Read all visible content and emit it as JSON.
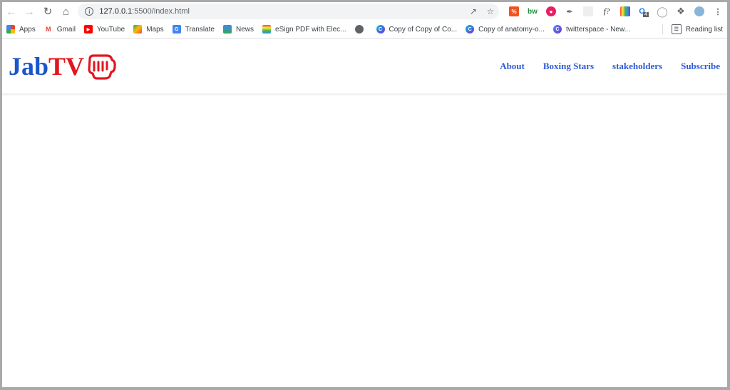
{
  "browser": {
    "url_host": "127.0.0.1",
    "url_rest": ":5500/index.html",
    "bookmarks": [
      {
        "label": "Apps",
        "icon": "apps-grid-icon"
      },
      {
        "label": "Gmail",
        "icon": "gmail-icon"
      },
      {
        "label": "YouTube",
        "icon": "youtube-icon"
      },
      {
        "label": "Maps",
        "icon": "maps-icon"
      },
      {
        "label": "Translate",
        "icon": "translate-icon"
      },
      {
        "label": "News",
        "icon": "news-icon"
      },
      {
        "label": "eSign PDF with Elec...",
        "icon": "esign-icon"
      },
      {
        "label": "",
        "icon": "globe-icon"
      },
      {
        "label": "Copy of Copy of Co...",
        "icon": "canva-icon"
      },
      {
        "label": "Copy of anatomy-o...",
        "icon": "canva-icon"
      },
      {
        "label": "twitterspace - New...",
        "icon": "canva-icon"
      }
    ],
    "reading_list": "Reading list",
    "ext_badge": "4",
    "ext_bw": "bw",
    "ext_f": "f?"
  },
  "site": {
    "logo_part1": "Jab",
    "logo_part2": "TV",
    "nav": [
      "About",
      "Boxing Stars",
      "stakeholders",
      "Subscribe"
    ]
  }
}
